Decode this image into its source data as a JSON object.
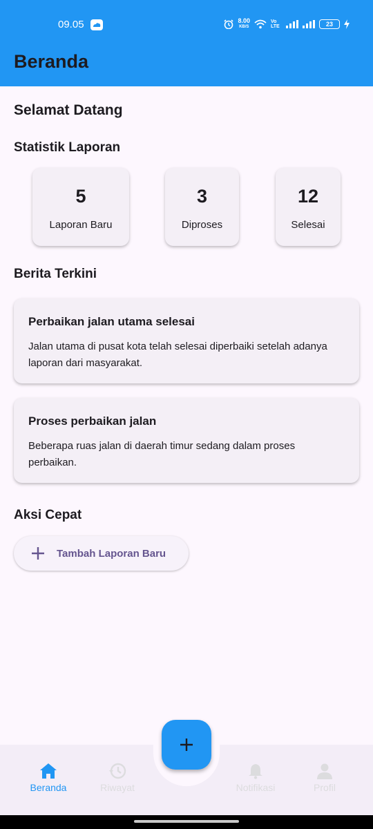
{
  "status_bar": {
    "time": "09.05",
    "speed_value": "8.00",
    "speed_unit": "KB/S",
    "network_label": "Vo LTE",
    "battery": "23"
  },
  "app_bar": {
    "title": "Beranda"
  },
  "welcome": "Selamat Datang",
  "stats": {
    "title": "Statistik Laporan",
    "items": [
      {
        "value": "5",
        "label": "Laporan Baru"
      },
      {
        "value": "3",
        "label": "Diproses"
      },
      {
        "value": "12",
        "label": "Selesai"
      }
    ]
  },
  "news": {
    "title": "Berita Terkini",
    "items": [
      {
        "title": "Perbaikan jalan utama selesai",
        "body": "Jalan utama di pusat kota telah selesai diperbaiki setelah adanya laporan dari masyarakat."
      },
      {
        "title": "Proses perbaikan jalan",
        "body": "Beberapa ruas jalan di daerah timur sedang dalam proses perbaikan."
      }
    ]
  },
  "quick_actions": {
    "title": "Aksi Cepat",
    "add_report_label": "Tambah Laporan Baru"
  },
  "fab_icon": "plus-icon",
  "bottom_nav": {
    "items": [
      {
        "label": "Beranda",
        "icon": "home-icon",
        "active": true
      },
      {
        "label": "Riwayat",
        "icon": "history-icon",
        "active": false
      },
      {
        "label": "Notifikasi",
        "icon": "bell-icon",
        "active": false
      },
      {
        "label": "Profil",
        "icon": "person-icon",
        "active": false
      }
    ]
  },
  "colors": {
    "primary": "#2196f3",
    "accent": "#65558f",
    "background": "#fdf7fe",
    "card": "#f4eff6"
  }
}
